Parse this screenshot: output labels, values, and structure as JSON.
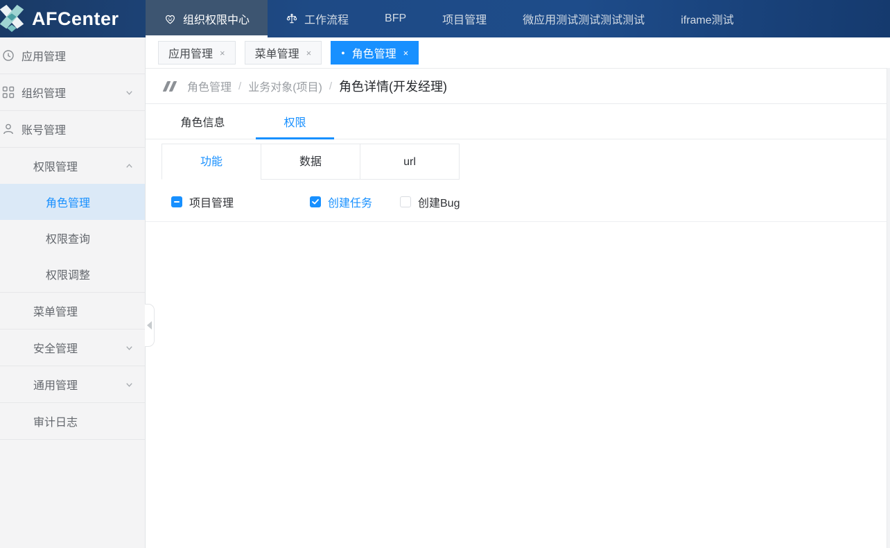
{
  "brand": {
    "name": "AFCenter"
  },
  "navbar": {
    "items": [
      {
        "label": "组织权限中心",
        "icon": "heart-smile",
        "active": true
      },
      {
        "label": "工作流程",
        "icon": "balance-scale"
      },
      {
        "label": "BFP"
      },
      {
        "label": "项目管理"
      },
      {
        "label": "微应用测试测试测试测试"
      },
      {
        "label": "iframe测试"
      }
    ]
  },
  "sidebar": {
    "items": [
      {
        "label": "应用管理",
        "icon": "clock"
      },
      {
        "label": "组织管理",
        "icon": "org-nodes",
        "chevron": "down"
      },
      {
        "label": "账号管理",
        "icon": "user"
      },
      {
        "label": "权限管理",
        "chevron": "up",
        "expanded": true
      },
      {
        "label": "角色管理",
        "sub": true,
        "active": true
      },
      {
        "label": "权限查询",
        "sub": true
      },
      {
        "label": "权限调整",
        "sub": true
      },
      {
        "label": "菜单管理"
      },
      {
        "label": "安全管理",
        "chevron": "down"
      },
      {
        "label": "通用管理",
        "chevron": "down"
      },
      {
        "label": "审计日志"
      }
    ]
  },
  "window_tabs": {
    "close_glyph": "×",
    "active_dot": "●",
    "items": [
      {
        "label": "应用管理"
      },
      {
        "label": "菜单管理"
      },
      {
        "label": "角色管理",
        "active": true
      }
    ]
  },
  "breadcrumb": {
    "separator": "/",
    "items": [
      "角色管理",
      "业务对象(项目)",
      "角色详情(开发经理)"
    ]
  },
  "role_tabs": {
    "items": [
      {
        "label": "角色信息"
      },
      {
        "label": "权限",
        "active": true
      }
    ]
  },
  "permission_type_tabs": {
    "items": [
      {
        "label": "功能",
        "active": true
      },
      {
        "label": "数据"
      },
      {
        "label": "url"
      }
    ]
  },
  "permission_tree": {
    "items": [
      {
        "label": "项目管理",
        "state": "indeterminate"
      },
      {
        "label": "创建任务",
        "state": "checked"
      },
      {
        "label": "创建Bug",
        "state": "unchecked"
      }
    ]
  },
  "colors": {
    "accent": "#1890ff",
    "navbar_active_underline": "#ffffff",
    "sidebar_active_bg": "#dbe9f7",
    "sidebar_active_text": "#1890ff"
  }
}
